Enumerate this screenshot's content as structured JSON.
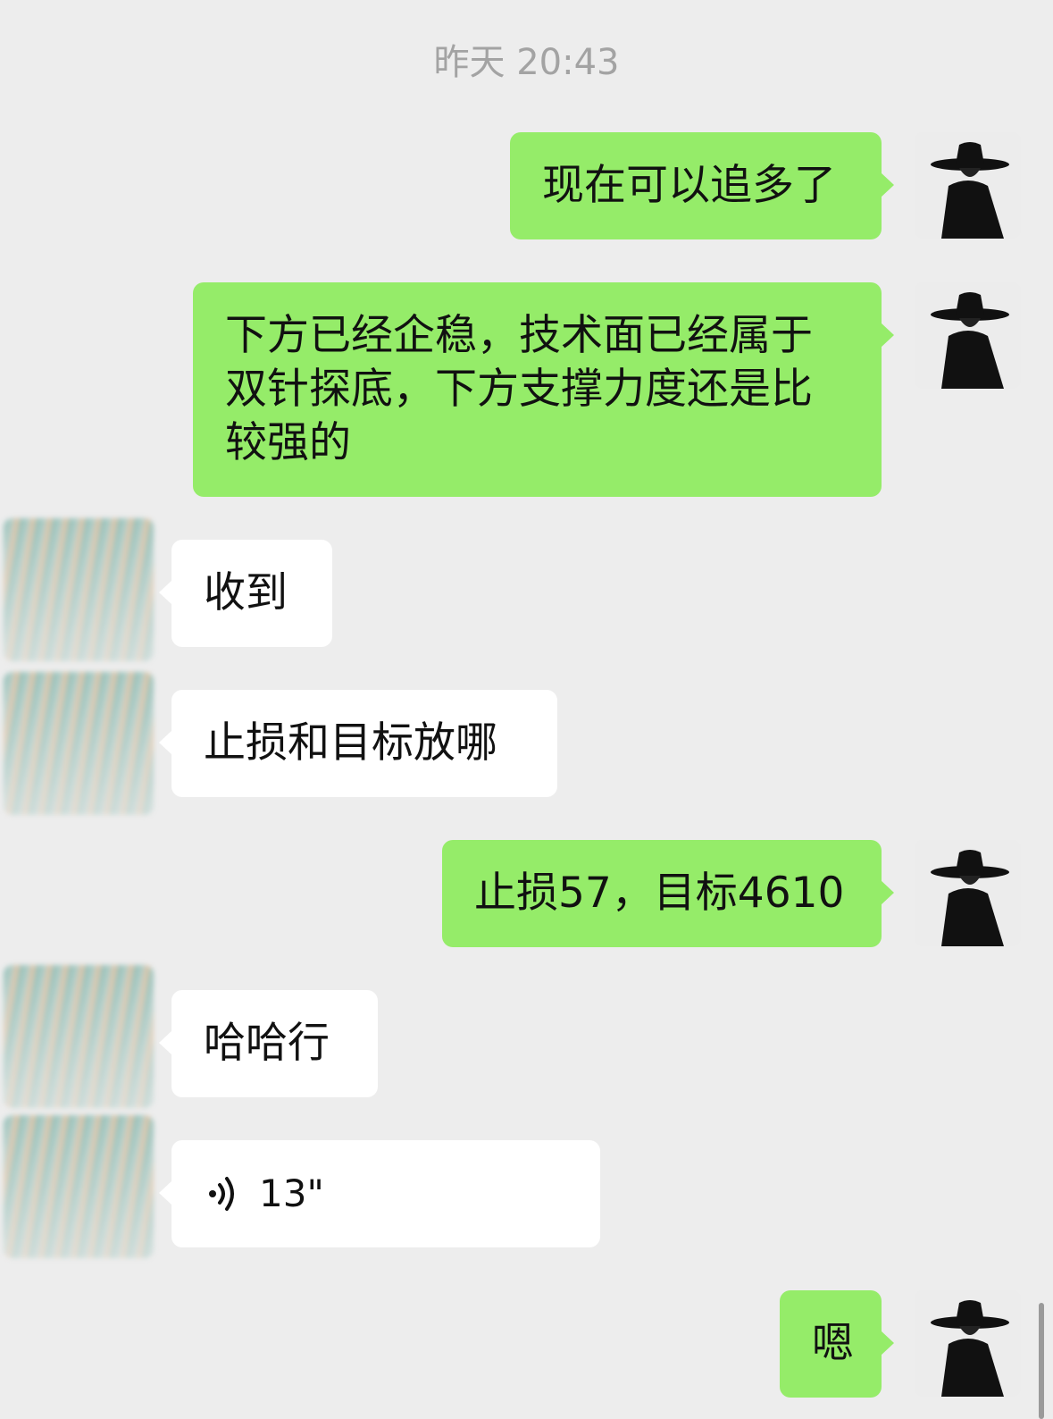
{
  "header": {
    "timestamp": "昨天 20:43"
  },
  "messages": [
    {
      "from": "self",
      "text": "现在可以追多了"
    },
    {
      "from": "self",
      "text": "下方已经企稳，技术面已经属于双针探底，下方支撑力度还是比较强的"
    },
    {
      "from": "other",
      "text": "收到"
    },
    {
      "from": "other",
      "text": "止损和目标放哪"
    },
    {
      "from": "self",
      "text": "止损57，目标4610"
    },
    {
      "from": "other",
      "text": "哈哈行"
    },
    {
      "from": "other",
      "type": "voice",
      "duration": "13\""
    },
    {
      "from": "self",
      "text": "嗯"
    }
  ],
  "colors": {
    "background": "#ededed",
    "self_bubble": "#95ec69",
    "other_bubble": "#ffffff",
    "timestamp": "#a3a3a3"
  },
  "icons": {
    "voice": "voice-wave-icon",
    "self_avatar": "hat-silhouette-avatar",
    "other_avatar": "blurred-avatar"
  }
}
